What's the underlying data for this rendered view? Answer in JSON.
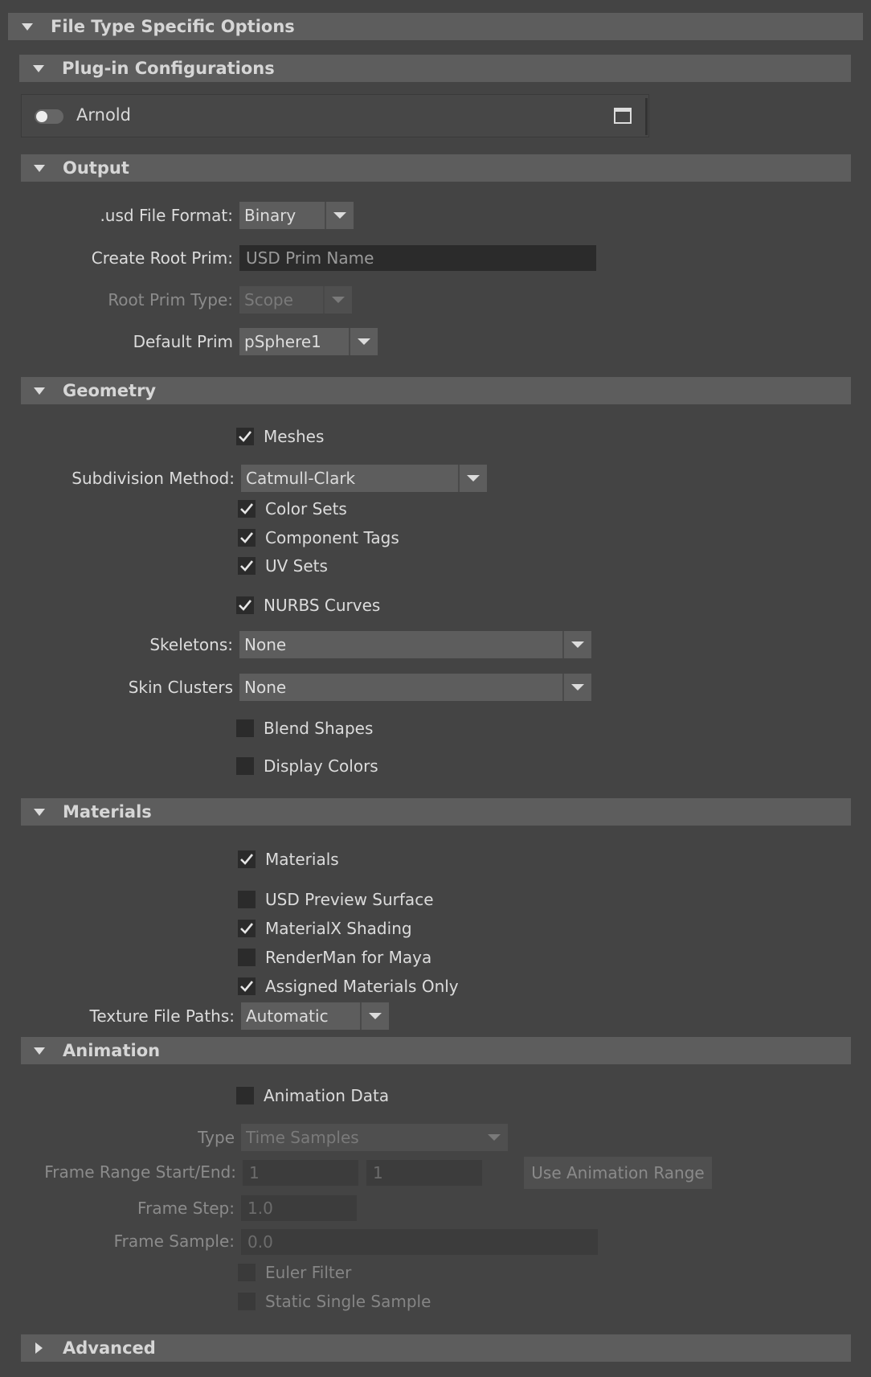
{
  "sections": {
    "file_type": "File Type Specific Options",
    "plugin": "Plug-in Configurations",
    "output": "Output",
    "geometry": "Geometry",
    "materials": "Materials",
    "animation": "Animation",
    "advanced": "Advanced"
  },
  "plugin": {
    "arnold_label": "Arnold",
    "arnold_enabled": false
  },
  "output": {
    "usd_format_label": ".usd File Format:",
    "usd_format_value": "Binary",
    "root_prim_label": "Create Root Prim:",
    "root_prim_placeholder": "USD Prim Name",
    "root_prim_type_label": "Root Prim Type:",
    "root_prim_type_value": "Scope",
    "default_prim_label": "Default Prim",
    "default_prim_value": "pSphere1"
  },
  "geometry": {
    "meshes": "Meshes",
    "subdivision_label": "Subdivision Method:",
    "subdivision_value": "Catmull-Clark",
    "color_sets": "Color Sets",
    "component_tags": "Component Tags",
    "uv_sets": "UV Sets",
    "nurbs_curves": "NURBS Curves",
    "skeletons_label": "Skeletons:",
    "skeletons_value": "None",
    "skin_clusters_label": "Skin Clusters",
    "skin_clusters_value": "None",
    "blend_shapes": "Blend Shapes",
    "display_colors": "Display Colors"
  },
  "materials": {
    "materials": "Materials",
    "usd_preview_surface": "USD Preview Surface",
    "materialx_shading": "MaterialX Shading",
    "renderman": "RenderMan for Maya",
    "assigned_only": "Assigned Materials Only",
    "texture_paths_label": "Texture File Paths:",
    "texture_paths_value": "Automatic"
  },
  "animation": {
    "animation_data": "Animation Data",
    "type_label": "Type",
    "type_value": "Time Samples",
    "frame_range_label": "Frame Range Start/End:",
    "frame_start": "1",
    "frame_end": "1",
    "use_anim_range": "Use Animation Range",
    "frame_step_label": "Frame Step:",
    "frame_step_value": "1.0",
    "frame_sample_label": "Frame Sample:",
    "frame_sample_value": "0.0",
    "euler_filter": "Euler Filter",
    "static_single_sample": "Static Single Sample"
  },
  "colors": {
    "background": "#444444",
    "header": "#5d5d5d",
    "field": "#2b2b2b"
  }
}
